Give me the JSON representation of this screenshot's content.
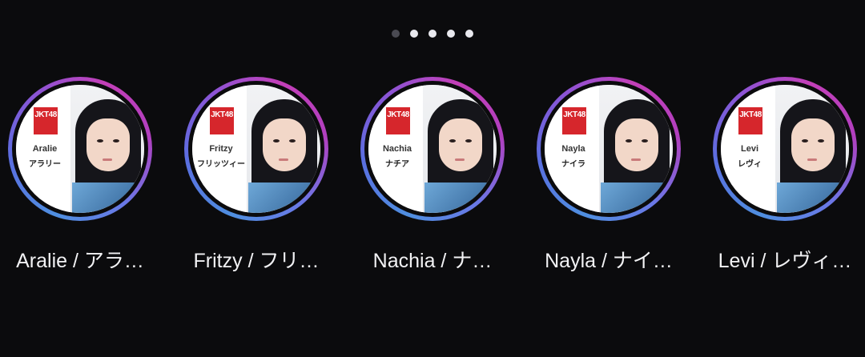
{
  "pager": {
    "total": 5,
    "active_index": 1
  },
  "stories": [
    {
      "display_name": "Aralie / アラ…",
      "tag_en": "Aralie",
      "tag_jp": "アラリー",
      "logo": "JKT48"
    },
    {
      "display_name": "Fritzy / フリ…",
      "tag_en": "Fritzy",
      "tag_jp": "フリッツィー",
      "logo": "JKT48"
    },
    {
      "display_name": "Nachia / ナ…",
      "tag_en": "Nachia",
      "tag_jp": "ナチア",
      "logo": "JKT48"
    },
    {
      "display_name": "Nayla / ナイ…",
      "tag_en": "Nayla",
      "tag_jp": "ナイラ",
      "logo": "JKT48"
    },
    {
      "display_name": "Levi / レヴィ…",
      "tag_en": "Levi",
      "tag_jp": "レヴィ",
      "logo": "JKT48"
    }
  ],
  "colors": {
    "background": "#0b0b0d",
    "ring_start": "#4f8fe0",
    "ring_end": "#c33fb8",
    "text": "#f2f2f4",
    "logo_red": "#d6262c"
  }
}
